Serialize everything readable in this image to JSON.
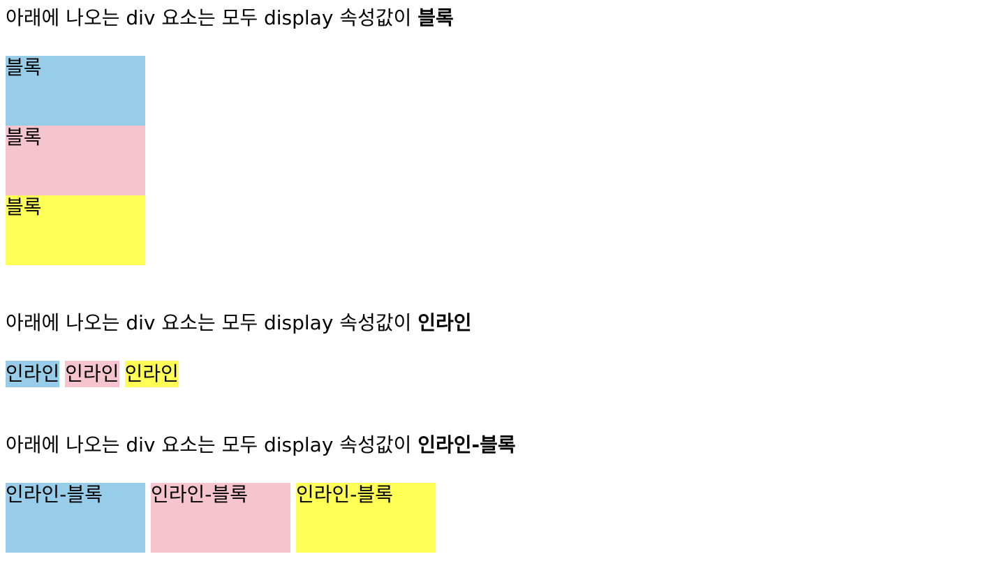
{
  "sections": [
    {
      "heading_prefix": "아래에 나오는 div 요소는 모두 display 속성값이 ",
      "heading_value": "블록",
      "items": [
        "블록",
        "블록",
        "블록"
      ]
    },
    {
      "heading_prefix": "아래에 나오는 div 요소는 모두 display 속성값이 ",
      "heading_value": "인라인",
      "items": [
        "인라인",
        "인라인",
        "인라인"
      ]
    },
    {
      "heading_prefix": "아래에 나오는 div 요소는 모두 display 속성값이 ",
      "heading_value": "인라인-블록",
      "items": [
        "인라인-블록",
        "인라인-블록",
        "인라인-블록"
      ]
    }
  ],
  "colors": {
    "blue": "#97cde8",
    "pink": "#f6c4ce",
    "yellow": "#ffff55"
  }
}
